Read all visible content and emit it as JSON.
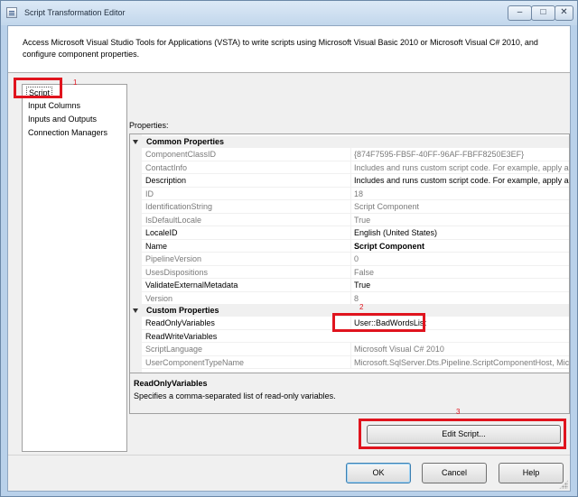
{
  "window": {
    "title": "Script Transformation Editor",
    "minimize_glyph": "–",
    "maximize_glyph": "□",
    "close_glyph": "✕"
  },
  "header": {
    "text": "Access Microsoft Visual Studio Tools for Applications (VSTA) to write scripts using Microsoft Visual Basic 2010 or Microsoft Visual C# 2010, and configure component properties."
  },
  "nav": {
    "items": [
      {
        "label": "Script",
        "selected": true
      },
      {
        "label": "Input Columns"
      },
      {
        "label": "Inputs and Outputs"
      },
      {
        "label": "Connection Managers"
      }
    ]
  },
  "properties": {
    "label": "Properties:",
    "categories": [
      {
        "label": "Common Properties",
        "rows": [
          {
            "name": "ComponentClassID",
            "value": "{874F7595-FB5F-40FF-96AF-FBFF8250E3EF}",
            "readonly": true
          },
          {
            "name": "ContactInfo",
            "value": "Includes and runs custom script code. For example, apply a b",
            "readonly": true
          },
          {
            "name": "Description",
            "value": "Includes and runs custom script code. For example, apply a b"
          },
          {
            "name": "ID",
            "value": "18",
            "readonly": true
          },
          {
            "name": "IdentificationString",
            "value": "Script Component",
            "readonly": true
          },
          {
            "name": "IsDefaultLocale",
            "value": "True",
            "readonly": true
          },
          {
            "name": "LocaleID",
            "value": "English (United States)"
          },
          {
            "name": "Name",
            "value": "Script Component",
            "bold": true
          },
          {
            "name": "PipelineVersion",
            "value": "0",
            "readonly": true
          },
          {
            "name": "UsesDispositions",
            "value": "False",
            "readonly": true
          },
          {
            "name": "ValidateExternalMetadata",
            "value": "True"
          },
          {
            "name": "Version",
            "value": "8",
            "readonly": true
          }
        ]
      },
      {
        "label": "Custom Properties",
        "rows": [
          {
            "name": "ReadOnlyVariables",
            "value": "User::BadWordsList"
          },
          {
            "name": "ReadWriteVariables",
            "value": ""
          },
          {
            "name": "ScriptLanguage",
            "value": "Microsoft Visual C# 2010",
            "readonly": true
          },
          {
            "name": "UserComponentTypeName",
            "value": "Microsoft.SqlServer.Dts.Pipeline.ScriptComponentHost, Micr",
            "readonly": true
          }
        ]
      }
    ]
  },
  "description": {
    "title": "ReadOnlyVariables",
    "text": "Specifies a comma-separated list of read-only variables."
  },
  "buttons": {
    "edit_script": "Edit Script...",
    "ok": "OK",
    "cancel": "Cancel",
    "help": "Help"
  },
  "annotations": {
    "n1": "1",
    "n2": "2",
    "n3": "3",
    "color": "#e0141e"
  }
}
